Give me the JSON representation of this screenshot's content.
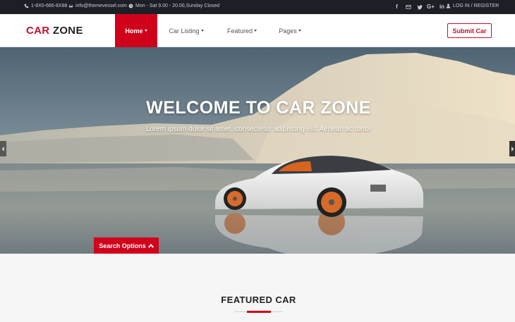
{
  "topbar": {
    "phone": "1-8X0-666-8X88",
    "email": "info@themevessel.com",
    "hours": "Mon - Sat 9.00 - 20.00,Sunday Closed",
    "social_icons": [
      "facebook-icon",
      "mail-icon",
      "twitter-icon",
      "google-plus-icon",
      "linkedin-icon"
    ],
    "social_google": "G+",
    "social_linkedin": "in",
    "login": "LOG IN / REGISTER"
  },
  "brand": {
    "part1": "CAR",
    "part2": "ZONE"
  },
  "nav": {
    "items": [
      {
        "label": "Home",
        "active": true
      },
      {
        "label": "Car Listing",
        "active": false
      },
      {
        "label": "Featured",
        "active": false
      },
      {
        "label": "Pages",
        "active": false
      }
    ],
    "submit_label": "Submit Car"
  },
  "hero": {
    "title": "WELCOME TO CAR ZONE",
    "subtitle": "Lorem ipsum dolor sit amet, consectetur adipiscing elit. Aenean ac tortor",
    "search_options": "Search Options"
  },
  "featured": {
    "title": "FEATURED CAR"
  },
  "colors": {
    "accent": "#d0021b",
    "topbar": "#1c1f26"
  }
}
